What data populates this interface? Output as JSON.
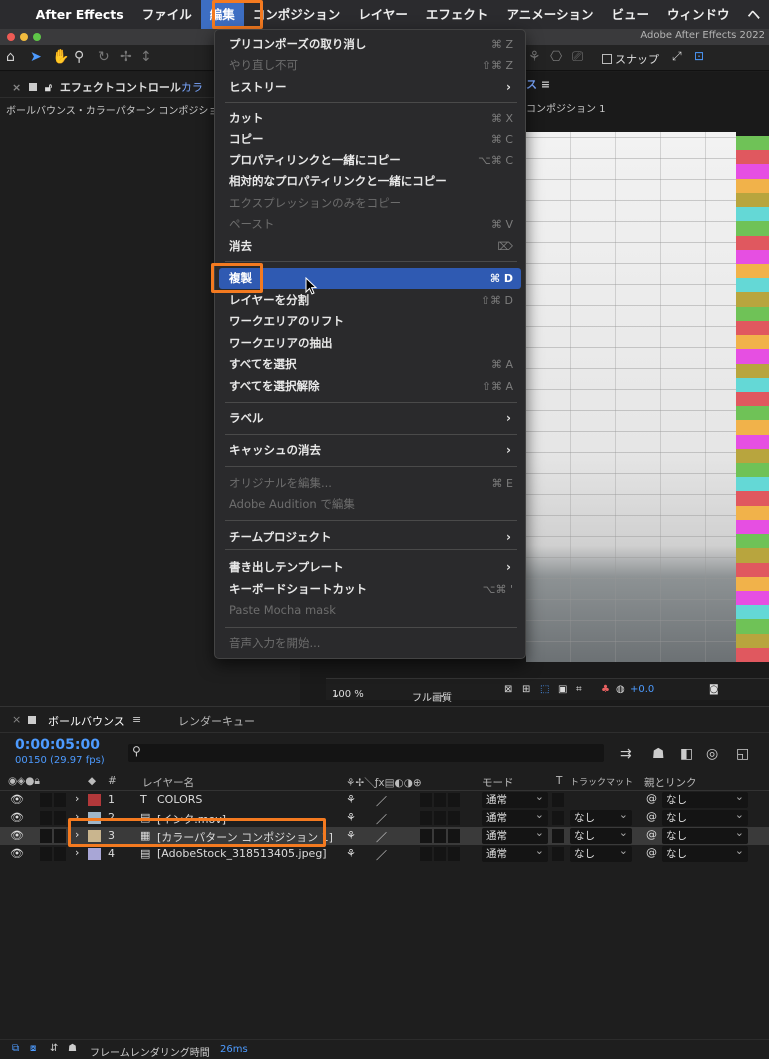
{
  "menubar": {
    "apple_icon": "apple-icon",
    "app_name": "After Effects",
    "items": [
      "ファイル",
      "編集",
      "コンポジション",
      "レイヤー",
      "エフェクト",
      "アニメーション",
      "ビュー",
      "ウィンドウ",
      "ヘ"
    ]
  },
  "window": {
    "title": "Adobe After Effects 2022"
  },
  "toolbar": {
    "snap_label": "スナップ"
  },
  "effect_panel": {
    "tab_label": "エフェクトコントロール",
    "tab_target": "カラ",
    "subtitle": "ボールバウンス・カラーパターン コンポジショ"
  },
  "composition": {
    "tab_label": "ス",
    "subtitle": "コンポジション 1",
    "zoom": "100 %",
    "resolution": "フル画質",
    "exposure": "+0.0"
  },
  "edit_menu": {
    "items": [
      {
        "label": "プリコンポーズの取り消し",
        "shortcut": "⌘ Z"
      },
      {
        "label": "やり直し不可",
        "shortcut": "⇧⌘ Z",
        "disabled": true
      },
      {
        "label": "ヒストリー",
        "submenu": true
      },
      {
        "label": "カット",
        "shortcut": "⌘ X"
      },
      {
        "label": "コピー",
        "shortcut": "⌘ C"
      },
      {
        "label": "プロパティリンクと一緒にコピー",
        "shortcut": "⌥⌘ C"
      },
      {
        "label": "相対的なプロパティリンクと一緒にコピー"
      },
      {
        "label": "エクスプレッションのみをコピー",
        "disabled": true
      },
      {
        "label": "ペースト",
        "shortcut": "⌘ V",
        "disabled": true
      },
      {
        "label": "消去",
        "shortcut": "⌦"
      },
      {
        "label": "複製",
        "shortcut": "⌘ D",
        "highlighted": true
      },
      {
        "label": "レイヤーを分割",
        "shortcut": "⇧⌘ D"
      },
      {
        "label": "ワークエリアのリフト"
      },
      {
        "label": "ワークエリアの抽出"
      },
      {
        "label": "すべてを選択",
        "shortcut": "⌘ A"
      },
      {
        "label": "すべてを選択解除",
        "shortcut": "⇧⌘ A"
      },
      {
        "label": "ラベル",
        "submenu": true
      },
      {
        "label": "キャッシュの消去",
        "submenu": true
      },
      {
        "label": "オリジナルを編集...",
        "shortcut": "⌘ E",
        "disabled": true
      },
      {
        "label": "Adobe Audition で編集",
        "disabled": true
      },
      {
        "label": "チームプロジェクト",
        "submenu": true
      },
      {
        "label": "書き出しテンプレート",
        "submenu": true
      },
      {
        "label": "キーボードショートカット",
        "shortcut": "⌥⌘ '"
      },
      {
        "label": "Paste Mocha mask",
        "disabled": true
      },
      {
        "label": "音声入力を開始...",
        "disabled": true
      }
    ]
  },
  "timeline": {
    "tab_active": "ボールバウンス",
    "tab_render": "レンダーキュー",
    "timecode": "0:00:05:00",
    "frame_info": "00150 (29.97 fps)",
    "search_icon": "search-icon",
    "columns": {
      "layer_name": "レイヤー名",
      "mode": "モード",
      "track_matte_t": "T",
      "track_matte": "トラックマット",
      "parent": "親とリンク"
    },
    "layers": [
      {
        "num": "1",
        "type": "T",
        "name": "COLORS",
        "color": "#b2383a",
        "mode": "通常",
        "matte": "",
        "parent": "なし"
      },
      {
        "num": "2",
        "type": "file",
        "name": "[インク.mov]",
        "color": "#9fb6c9",
        "mode": "通常",
        "matte": "なし",
        "parent": "なし"
      },
      {
        "num": "3",
        "type": "comp",
        "name": "[カラーパターン コンポジション 1]",
        "color": "#c9b58e",
        "mode": "通常",
        "matte": "なし",
        "parent": "なし",
        "selected": true
      },
      {
        "num": "4",
        "type": "file",
        "name": "[AdobeStock_318513405.jpeg]",
        "color": "#a8a6d6",
        "mode": "通常",
        "matte": "なし",
        "parent": "なし"
      }
    ]
  },
  "statusbar": {
    "label": "フレームレンダリング時間",
    "value": "26ms"
  },
  "colors": {
    "accent_highlight": "#2f5ab2",
    "annotation_orange": "#f47a20",
    "timecode_blue": "#4d9bff",
    "stripe_colors": [
      "#6fc257",
      "#e0585f",
      "#e64fe2",
      "#f1b24a",
      "#b8a53e",
      "#64d8d6"
    ]
  }
}
